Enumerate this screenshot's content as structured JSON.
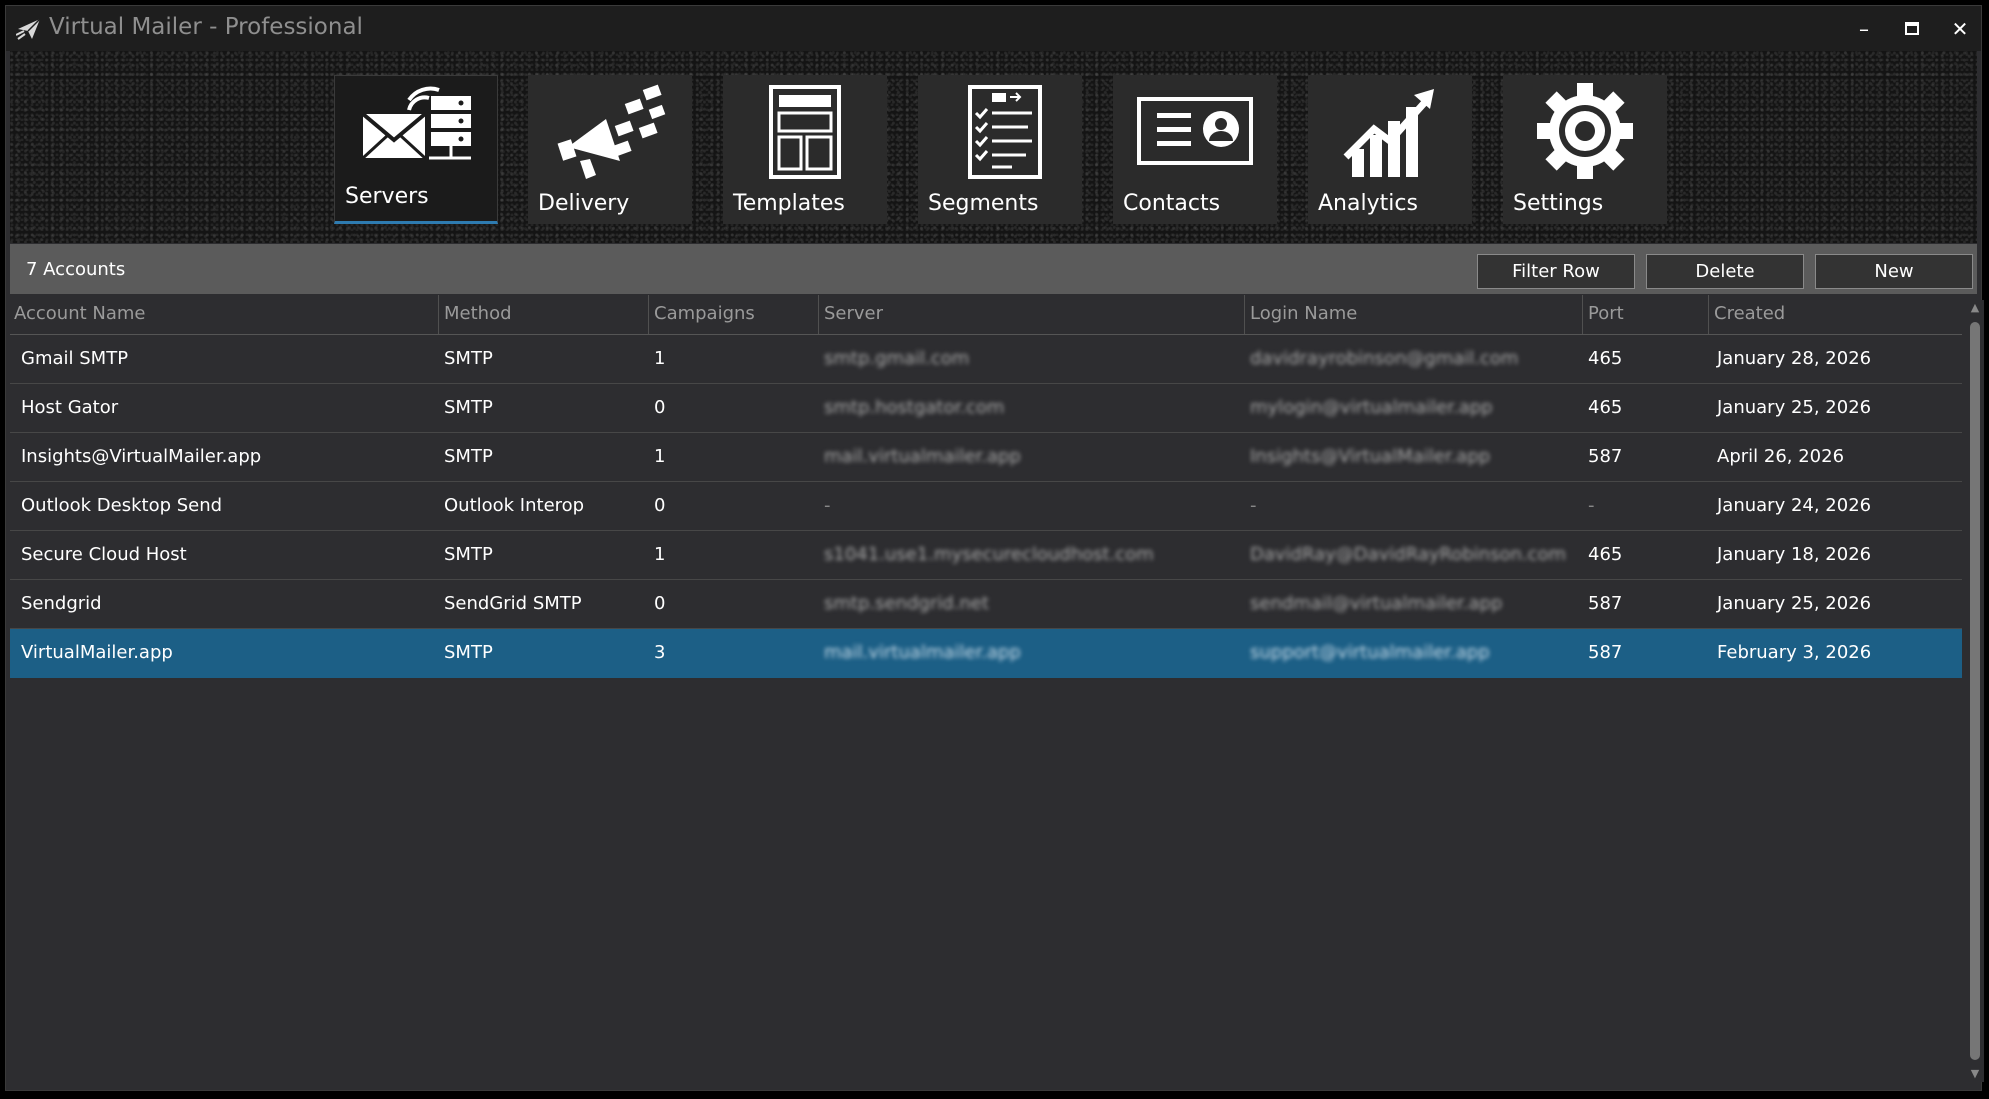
{
  "window": {
    "title": "Virtual Mailer - Professional",
    "controls": {
      "minimize": "–",
      "maximize": "▭",
      "close": "✕"
    }
  },
  "ribbon": {
    "tabs": [
      {
        "label": "Servers",
        "icon": "servers-icon",
        "active": true
      },
      {
        "label": "Delivery",
        "icon": "megaphone-icon",
        "active": false
      },
      {
        "label": "Templates",
        "icon": "template-icon",
        "active": false
      },
      {
        "label": "Segments",
        "icon": "checklist-icon",
        "active": false
      },
      {
        "label": "Contacts",
        "icon": "contact-card-icon",
        "active": false
      },
      {
        "label": "Analytics",
        "icon": "analytics-icon",
        "active": false
      },
      {
        "label": "Settings",
        "icon": "gear-icon",
        "active": false
      }
    ]
  },
  "toolbar": {
    "count": "7 Accounts",
    "filter_label": "Filter Row",
    "delete_label": "Delete",
    "new_label": "New"
  },
  "grid": {
    "columns": [
      "Account Name",
      "Method",
      "Campaigns",
      "Server",
      "Login Name",
      "Port",
      "Created"
    ],
    "rows": [
      {
        "name": "Gmail SMTP",
        "method": "SMTP",
        "campaigns": "1",
        "server": "smtp.gmail.com",
        "login": "davidrayrobinson@gmail.com",
        "port": "465",
        "created": "January 28, 2026",
        "selected": false
      },
      {
        "name": "Host Gator",
        "method": "SMTP",
        "campaigns": "0",
        "server": "smtp.hostgator.com",
        "login": "mylogin@virtualmailer.app",
        "port": "465",
        "created": "January 25, 2026",
        "selected": false
      },
      {
        "name": "Insights@VirtualMailer.app",
        "method": "SMTP",
        "campaigns": "1",
        "server": "mail.virtualmailer.app",
        "login": "Insights@VirtualMailer.app",
        "port": "587",
        "created": "April 26, 2026",
        "selected": false
      },
      {
        "name": "Outlook Desktop Send",
        "method": "Outlook Interop",
        "campaigns": "0",
        "server": "-",
        "login": "-",
        "port": "-",
        "created": "January 24, 2026",
        "selected": false
      },
      {
        "name": "Secure Cloud Host",
        "method": "SMTP",
        "campaigns": "1",
        "server": "s1041.use1.mysecurecloudhost.com",
        "login": "DavidRay@DavidRayRobinson.com",
        "port": "465",
        "created": "January 18, 2026",
        "selected": false
      },
      {
        "name": "Sendgrid",
        "method": "SendGrid SMTP",
        "campaigns": "0",
        "server": "smtp.sendgrid.net",
        "login": "sendmail@virtualmailer.app",
        "port": "587",
        "created": "January 25, 2026",
        "selected": false
      },
      {
        "name": "VirtualMailer.app",
        "method": "SMTP",
        "campaigns": "3",
        "server": "mail.virtualmailer.app",
        "login": "support@virtualmailer.app",
        "port": "587",
        "created": "February 3, 2026",
        "selected": true
      }
    ]
  },
  "colors": {
    "selected_row": "#1c5f86",
    "active_tab_underline": "#2e7bb0",
    "toolbar_bg": "#5b5b5b"
  }
}
